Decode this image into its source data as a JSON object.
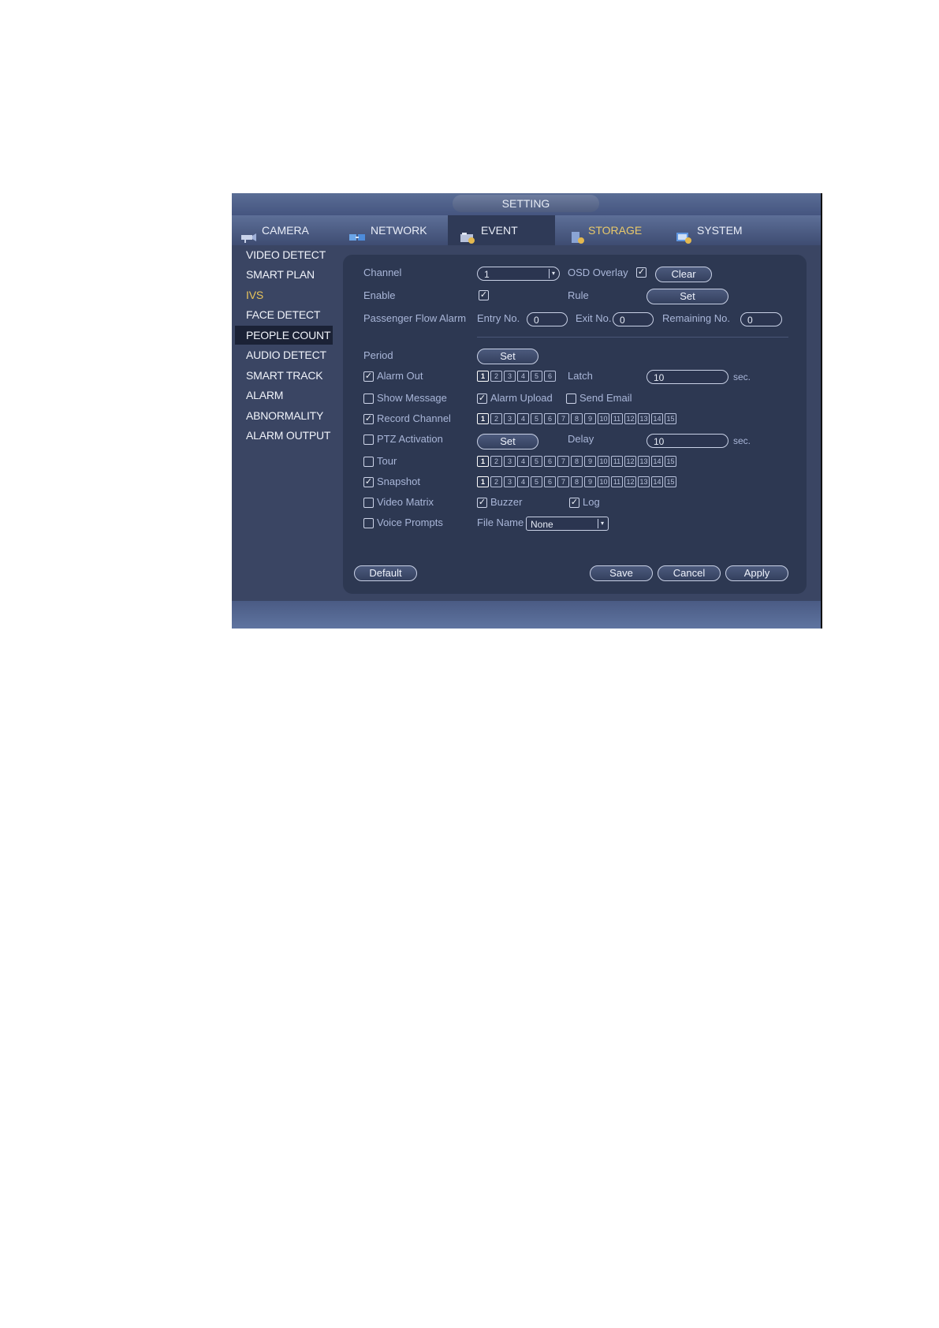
{
  "window": {
    "title": "SETTING"
  },
  "tabs": [
    {
      "label": "CAMERA",
      "icon": "camera-icon"
    },
    {
      "label": "NETWORK",
      "icon": "network-icon"
    },
    {
      "label": "EVENT",
      "icon": "event-icon",
      "active": true
    },
    {
      "label": "STORAGE",
      "icon": "storage-icon"
    },
    {
      "label": "SYSTEM",
      "icon": "system-icon"
    }
  ],
  "sidebar": {
    "items": [
      "VIDEO DETECT",
      "SMART PLAN",
      "IVS",
      "FACE DETECT",
      "PEOPLE COUNT",
      "AUDIO DETECT",
      "SMART TRACK",
      "ALARM",
      "ABNORMALITY",
      "ALARM OUTPUT"
    ],
    "active": "PEOPLE COUNT",
    "highlighted": "IVS"
  },
  "form": {
    "channel_label": "Channel",
    "channel_value": "1",
    "osd_overlay_label": "OSD Overlay",
    "osd_overlay_checked": true,
    "clear_label": "Clear",
    "enable_label": "Enable",
    "enable_checked": true,
    "rule_label": "Rule",
    "rule_set_label": "Set",
    "passenger_flow_label": "Passenger Flow Alarm",
    "entry_label": "Entry No.",
    "entry_value": "0",
    "exit_label": "Exit No.",
    "exit_value": "0",
    "remaining_label": "Remaining No.",
    "remaining_value": "0",
    "period_label": "Period",
    "period_set_label": "Set",
    "alarm_out_label": "Alarm Out",
    "alarm_out_channels": [
      "1",
      "2",
      "3",
      "4",
      "5",
      "6"
    ],
    "latch_label": "Latch",
    "latch_value": "10",
    "sec_label": "sec.",
    "show_message_label": "Show Message",
    "alarm_upload_label": "Alarm Upload",
    "send_email_label": "Send Email",
    "record_channel_label": "Record Channel",
    "record_channels": [
      "1",
      "2",
      "3",
      "4",
      "5",
      "6",
      "7",
      "8",
      "9",
      "10",
      "11",
      "12",
      "13",
      "14",
      "15"
    ],
    "ptz_label": "PTZ Activation",
    "ptz_set_label": "Set",
    "delay_label": "Delay",
    "delay_value": "10",
    "tour_label": "Tour",
    "tour_channels": [
      "1",
      "2",
      "3",
      "4",
      "5",
      "6",
      "7",
      "8",
      "9",
      "10",
      "11",
      "12",
      "13",
      "14",
      "15"
    ],
    "snapshot_label": "Snapshot",
    "snapshot_channels": [
      "1",
      "2",
      "3",
      "4",
      "5",
      "6",
      "7",
      "8",
      "9",
      "10",
      "11",
      "12",
      "13",
      "14",
      "15"
    ],
    "video_matrix_label": "Video Matrix",
    "buzzer_label": "Buzzer",
    "log_label": "Log",
    "voice_prompts_label": "Voice Prompts",
    "file_name_label": "File Name",
    "file_name_value": "None"
  },
  "buttons": {
    "default": "Default",
    "save": "Save",
    "cancel": "Cancel",
    "apply": "Apply"
  },
  "checks": {
    "alarm_out": true,
    "show_message": false,
    "alarm_upload": true,
    "send_email": false,
    "record_channel": true,
    "ptz": false,
    "tour": false,
    "snapshot": true,
    "video_matrix": false,
    "buzzer": true,
    "log": true,
    "voice_prompts": false
  },
  "colors": {
    "background": "#3a4563",
    "panel": "#2d3852",
    "highlight": "#e9c45b",
    "active_sidebar": "#1b2236"
  }
}
